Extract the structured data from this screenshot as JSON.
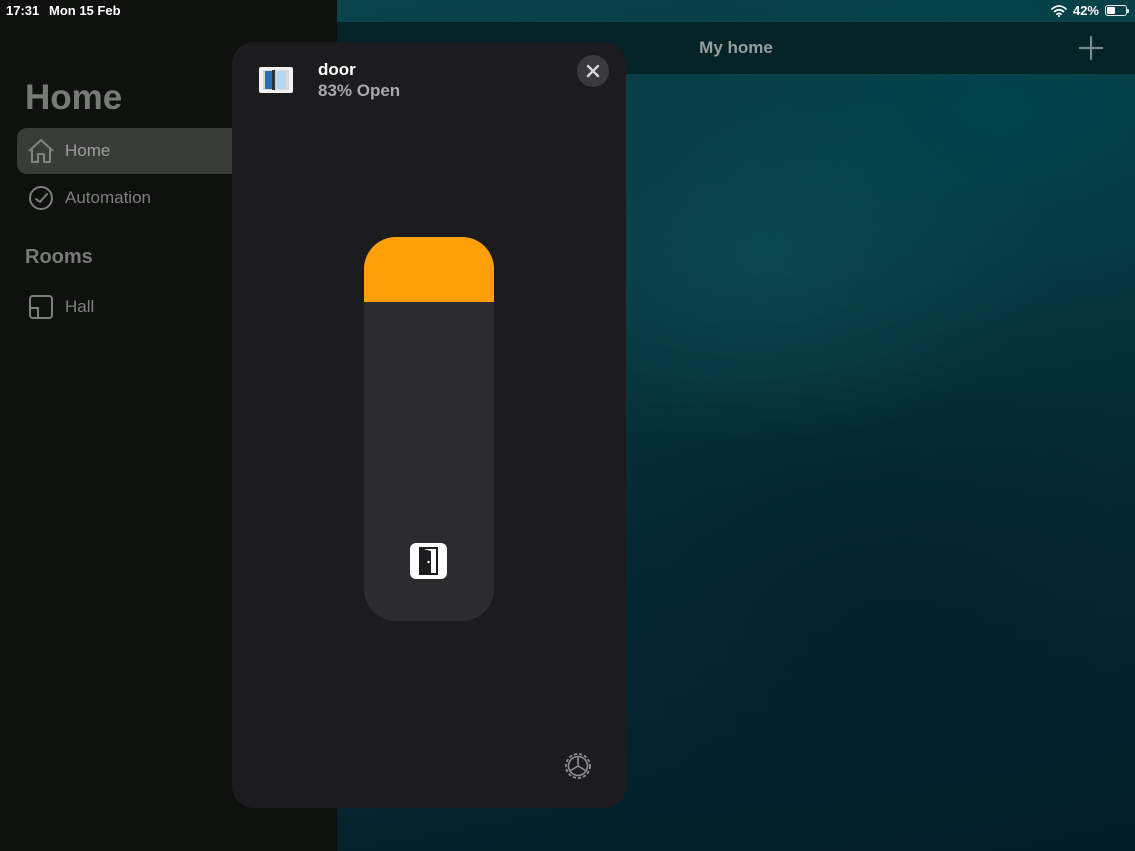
{
  "status_bar": {
    "time": "17:31",
    "date": "Mon 15 Feb",
    "battery": "42%"
  },
  "sidebar": {
    "title": "Home",
    "items": [
      {
        "label": "Home",
        "icon": "house-icon",
        "active": true
      },
      {
        "label": "Automation",
        "icon": "clock-icon",
        "active": false
      }
    ],
    "rooms_heading": "Rooms",
    "rooms": [
      {
        "label": "Hall",
        "icon": "room-icon"
      }
    ]
  },
  "topbar": {
    "title": "My home",
    "add_icon": "plus-icon"
  },
  "modal": {
    "device_name": "door",
    "device_state": "83% Open",
    "open_level": 0.17,
    "accent_color": "#ff9f0a",
    "close_icon": "close-icon",
    "settings_icon": "gear-icon",
    "slider_icon": "door-icon"
  }
}
